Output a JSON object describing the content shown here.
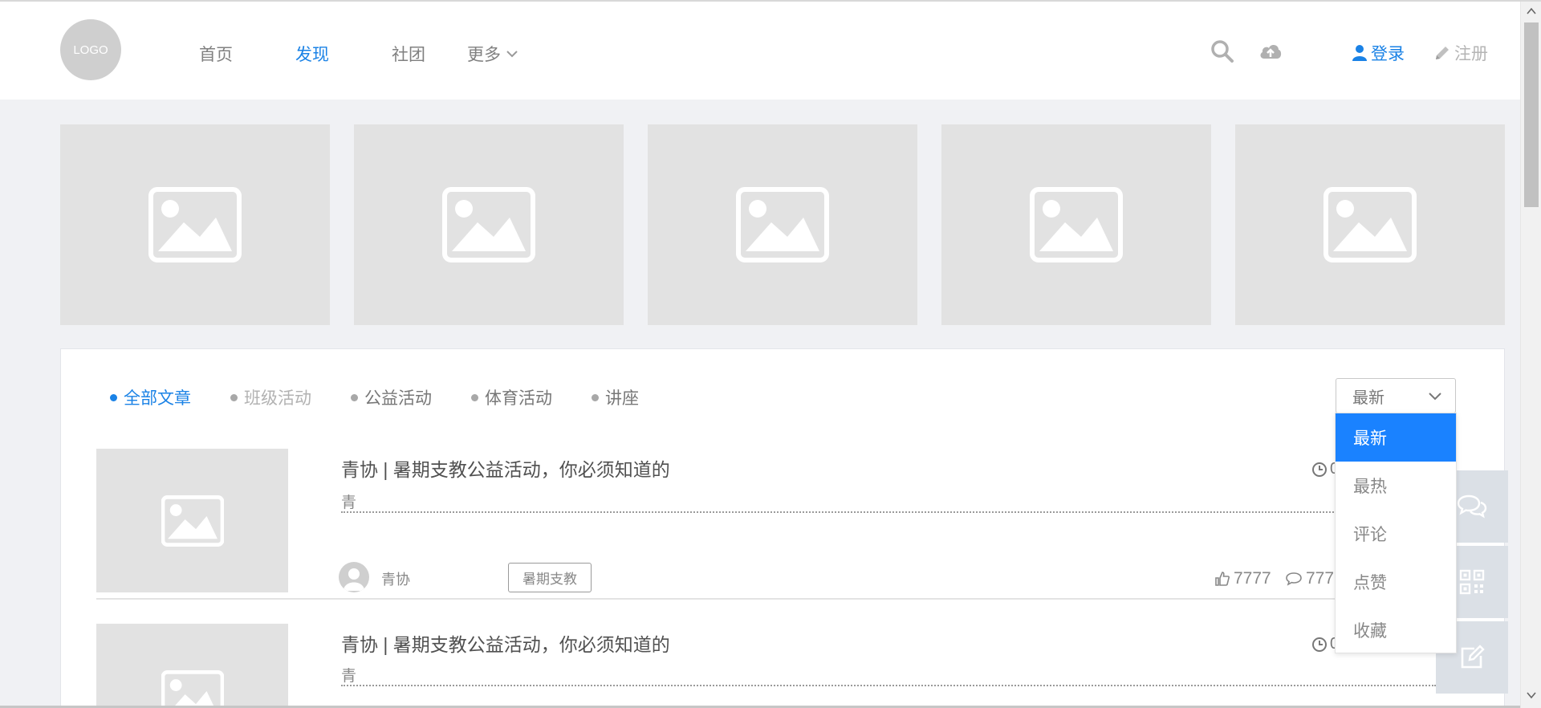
{
  "header": {
    "logo": "LOGO",
    "nav": [
      {
        "label": "首页"
      },
      {
        "label": "发现"
      },
      {
        "label": "社团"
      },
      {
        "label": "更多"
      }
    ],
    "login": "登录",
    "register": "注册"
  },
  "tabs": [
    {
      "label": "全部文章"
    },
    {
      "label": "班级活动"
    },
    {
      "label": "公益活动"
    },
    {
      "label": "体育活动"
    },
    {
      "label": "讲座"
    }
  ],
  "sort": {
    "selected": "最新",
    "options": [
      "最新",
      "最热",
      "评论",
      "点赞",
      "收藏"
    ]
  },
  "articles": [
    {
      "title": "青协 | 暑期支教公益活动，你必须知道的",
      "excerpt": "青",
      "date_fragment": "0",
      "author": "青协",
      "tag": "暑期支教",
      "likes": "7777",
      "comments": "777"
    },
    {
      "title": "青协 | 暑期支教公益活动，你必须知道的",
      "excerpt": "青",
      "date_fragment": "0"
    }
  ],
  "colors": {
    "accent": "#1a82e6",
    "selected_option": "#1a82ff"
  }
}
